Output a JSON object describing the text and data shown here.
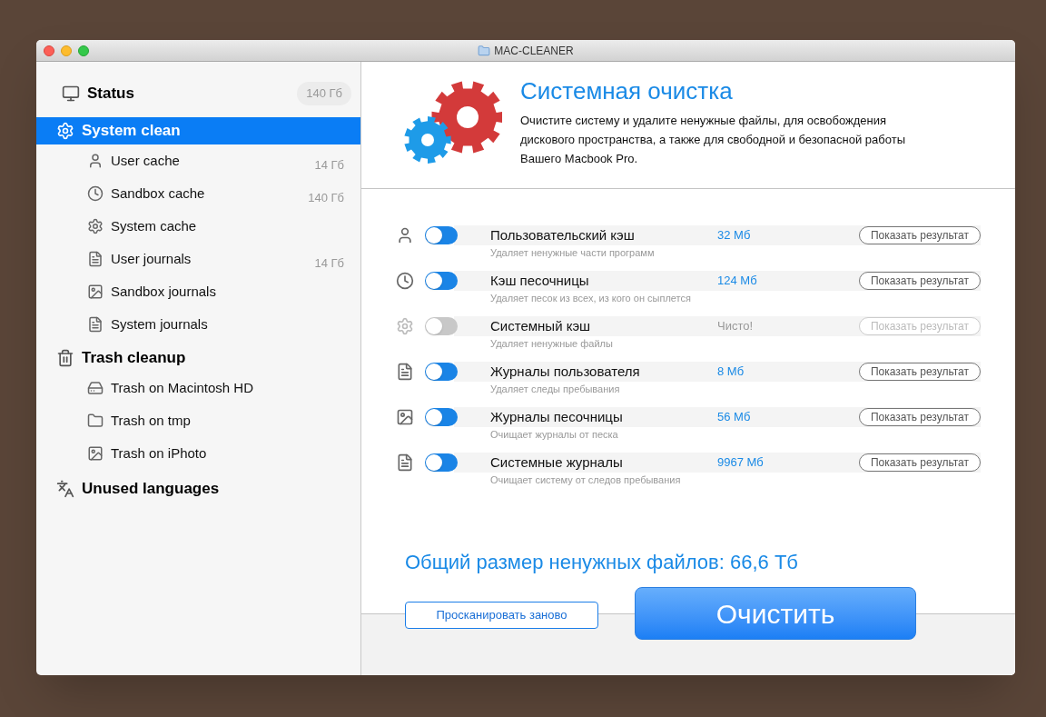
{
  "window": {
    "title": "MAC-CLEANER"
  },
  "sidebar": {
    "sections": [
      {
        "label": "Status",
        "badge": "140 Гб",
        "selected": false
      },
      {
        "label": "System clean",
        "selected": true,
        "children": [
          {
            "label": "User cache",
            "size": "14 Гб"
          },
          {
            "label": "Sandbox cache",
            "size": "140 Гб"
          },
          {
            "label": "System cache"
          },
          {
            "label": "User journals",
            "size": "14 Гб"
          },
          {
            "label": "Sandbox journals"
          },
          {
            "label": "System journals"
          }
        ]
      },
      {
        "label": "Trash cleanup",
        "selected": false,
        "children": [
          {
            "label": "Trash on Macintosh HD"
          },
          {
            "label": "Trash on tmp"
          },
          {
            "label": "Trash on iPhoto"
          }
        ]
      },
      {
        "label": "Unused languages",
        "selected": false
      }
    ]
  },
  "header": {
    "title": "Системная очистка",
    "description": "Очистите систему и удалите ненужные файлы, для освобождения дискового пространства, а также для свободной и безопасной работы Вашего Macbook Pro."
  },
  "tasks": [
    {
      "name": "Пользовательский кэш",
      "description": "Удаляет ненужные части программ",
      "size": "32 Мб",
      "button": "Показать результат",
      "disabled": false
    },
    {
      "name": "Кэш песочницы",
      "description": "Удаляет песок из всех, из кого он сыплется",
      "size": "124 Мб",
      "button": "Показать результат",
      "disabled": false
    },
    {
      "name": "Системный кэш",
      "description": "Удаляет ненужные файлы",
      "size": "Чисто!",
      "button": "Показать результат",
      "disabled": true
    },
    {
      "name": "Журналы пользователя",
      "description": "Удаляет следы пребывания",
      "size": "8 Мб",
      "button": "Показать результат",
      "disabled": false
    },
    {
      "name": "Журналы песочницы",
      "description": "Очищает журналы от песка",
      "size": "56 Мб",
      "button": "Показать результат",
      "disabled": false
    },
    {
      "name": "Системные журналы",
      "description": "Очищает систему от следов пребывания",
      "size": "9967 Мб",
      "button": "Показать результат",
      "disabled": false
    }
  ],
  "total": "Общий размер ненужных файлов: 66,6 Тб",
  "buttons": {
    "rescan": "Просканировать заново",
    "clean": "Очистить"
  }
}
